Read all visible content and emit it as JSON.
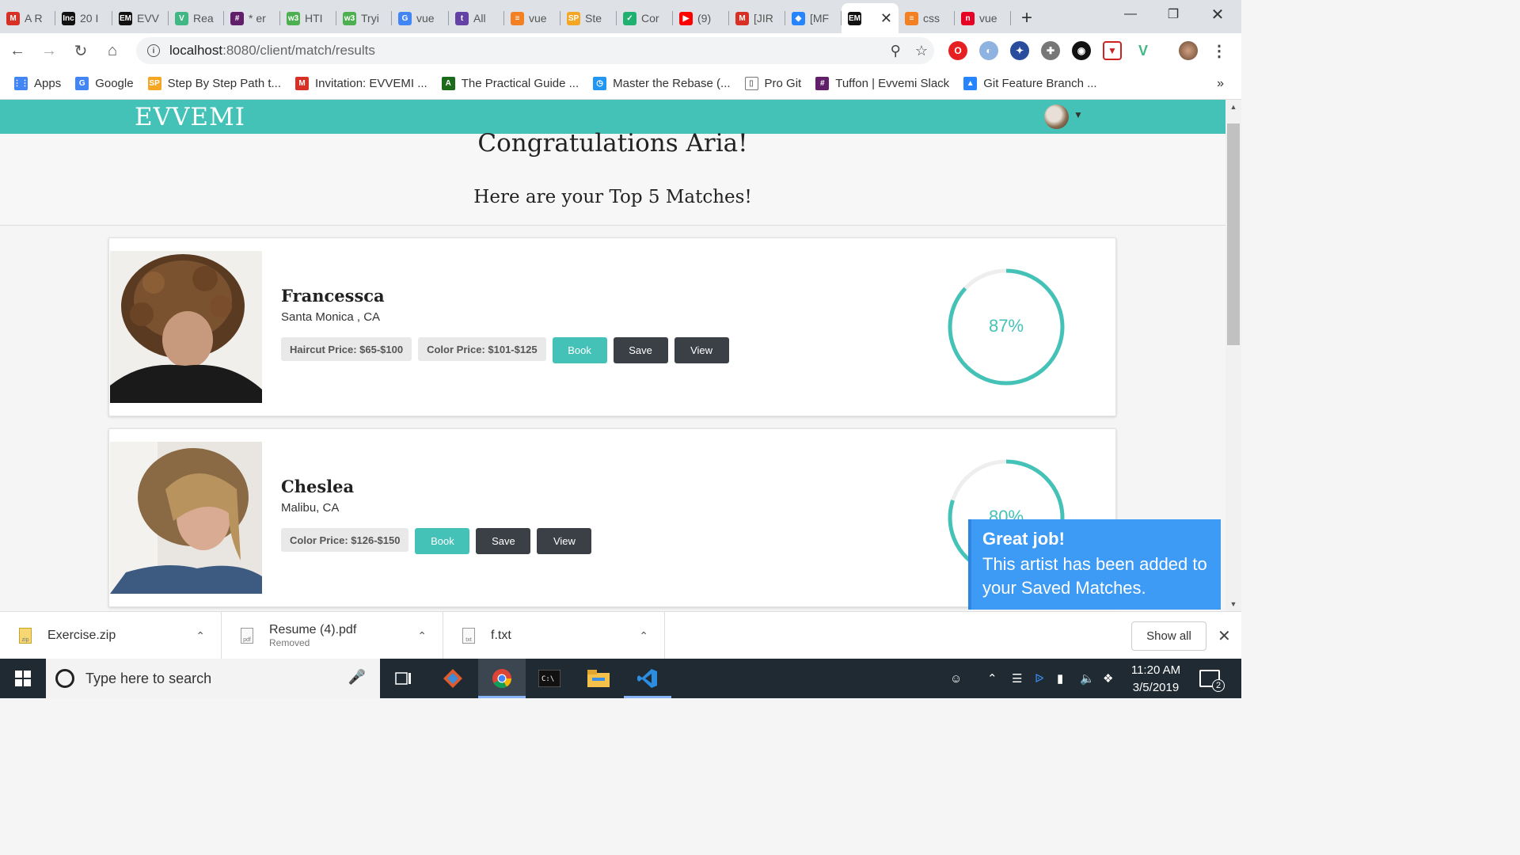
{
  "browser": {
    "tabs": [
      {
        "label": "A R",
        "icon": "gmail-icon",
        "color": "#d93025",
        "glyph": "M"
      },
      {
        "label": "20 I",
        "icon": "inc-icon",
        "color": "#111111",
        "glyph": "Inc"
      },
      {
        "label": "EVV",
        "icon": "evvemi-icon",
        "color": "#111111",
        "glyph": "EM"
      },
      {
        "label": "Rea",
        "icon": "vue-icon",
        "color": "#41b883",
        "glyph": "V"
      },
      {
        "label": "* er",
        "icon": "slack-icon",
        "color": "#611f69",
        "glyph": "#"
      },
      {
        "label": "HTI",
        "icon": "w3schools-icon",
        "color": "#4caf50",
        "glyph": "w3"
      },
      {
        "label": "Tryi",
        "icon": "w3schools-icon",
        "color": "#4caf50",
        "glyph": "w3"
      },
      {
        "label": "vue",
        "icon": "google-icon",
        "color": "#4285f4",
        "glyph": "G"
      },
      {
        "label": "All",
        "icon": "twitch-icon",
        "color": "#6441a5",
        "glyph": "t"
      },
      {
        "label": "vue",
        "icon": "stackoverflow-icon",
        "color": "#f48024",
        "glyph": "≡"
      },
      {
        "label": "Ste",
        "icon": "sp-icon",
        "color": "#f5a623",
        "glyph": "SP"
      },
      {
        "label": "Cor",
        "icon": "shield-icon",
        "color": "#20b070",
        "glyph": "✓"
      },
      {
        "label": "(9)",
        "icon": "youtube-icon",
        "color": "#ff0000",
        "glyph": "▶"
      },
      {
        "label": "[JIR",
        "icon": "gmail-icon",
        "color": "#d93025",
        "glyph": "M"
      },
      {
        "label": "[MF",
        "icon": "jira-icon",
        "color": "#2684ff",
        "glyph": "◆"
      },
      {
        "label": "",
        "icon": "evvemi-icon",
        "color": "#111111",
        "glyph": "EM",
        "active": true
      },
      {
        "label": "css",
        "icon": "stackoverflow-icon",
        "color": "#f48024",
        "glyph": "≡"
      },
      {
        "label": "vue",
        "icon": "pinterest-icon",
        "color": "#e60023",
        "glyph": "n"
      }
    ],
    "url_host": "localhost",
    "url_path": ":8080/client/match/results",
    "bookmarks": [
      {
        "label": "Apps",
        "icon": "apps-grid-icon",
        "color": "#4285f4",
        "glyph": "⋮⋮"
      },
      {
        "label": "Google",
        "icon": "google-icon",
        "color": "#4285f4",
        "glyph": "G"
      },
      {
        "label": "Step By Step Path t...",
        "icon": "sp-icon",
        "color": "#f5a623",
        "glyph": "SP"
      },
      {
        "label": "Invitation: EVVEMI ...",
        "icon": "gmail-icon",
        "color": "#d93025",
        "glyph": "M"
      },
      {
        "label": "The Practical Guide ...",
        "icon": "academind-icon",
        "color": "#1b6b1b",
        "glyph": "A"
      },
      {
        "label": "Master the Rebase (...",
        "icon": "timer-icon",
        "color": "#2196f3",
        "glyph": "◷"
      },
      {
        "label": "Pro Git",
        "icon": "document-icon",
        "color": "#ffffff",
        "glyph": "▯"
      },
      {
        "label": "Tuffon | Evvemi Slack",
        "icon": "slack-icon",
        "color": "#611f69",
        "glyph": "#"
      },
      {
        "label": "Git Feature Branch ...",
        "icon": "atlassian-icon",
        "color": "#2684ff",
        "glyph": "▲"
      }
    ],
    "bookmarks_more": "»"
  },
  "app": {
    "logo": "EVVEMI",
    "brand_color": "#45c2b7",
    "heading": "Congratulations Aria!",
    "subheading": "Here are your Top 5 Matches!",
    "matches": [
      {
        "name": "Francessca",
        "location": "Santa Monica , CA",
        "prices": [
          "Haircut Price: $65-$100",
          "Color Price: $101-$125"
        ],
        "book": "Book",
        "save": "Save",
        "view": "View",
        "match_percent": 87,
        "match_label": "87%"
      },
      {
        "name": "Cheslea",
        "location": "Malibu, CA",
        "prices": [
          "Color Price: $126-$150"
        ],
        "book": "Book",
        "save": "Save",
        "view": "View",
        "match_percent": 80,
        "match_label": "80%"
      }
    ],
    "toast": {
      "title": "Great job!",
      "message": "This artist has been added to your Saved Matches."
    }
  },
  "downloads": {
    "items": [
      {
        "name": "Exercise.zip",
        "status": ""
      },
      {
        "name": "Resume (4).pdf",
        "status": "Removed"
      },
      {
        "name": "f.txt",
        "status": ""
      }
    ],
    "show_all": "Show all"
  },
  "taskbar": {
    "search_placeholder": "Type here to search",
    "time": "11:20 AM",
    "date": "3/5/2019",
    "notifications": "2"
  }
}
